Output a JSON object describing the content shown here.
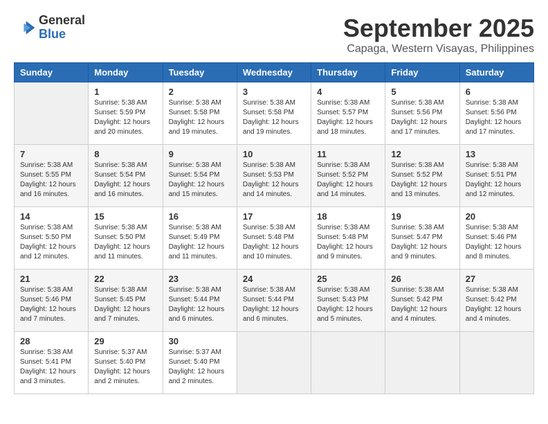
{
  "logo": {
    "general": "General",
    "blue": "Blue"
  },
  "title": "September 2025",
  "location": "Capaga, Western Visayas, Philippines",
  "days_of_week": [
    "Sunday",
    "Monday",
    "Tuesday",
    "Wednesday",
    "Thursday",
    "Friday",
    "Saturday"
  ],
  "weeks": [
    [
      {
        "day": "",
        "info": ""
      },
      {
        "day": "1",
        "info": "Sunrise: 5:38 AM\nSunset: 5:59 PM\nDaylight: 12 hours\nand 20 minutes."
      },
      {
        "day": "2",
        "info": "Sunrise: 5:38 AM\nSunset: 5:58 PM\nDaylight: 12 hours\nand 19 minutes."
      },
      {
        "day": "3",
        "info": "Sunrise: 5:38 AM\nSunset: 5:58 PM\nDaylight: 12 hours\nand 19 minutes."
      },
      {
        "day": "4",
        "info": "Sunrise: 5:38 AM\nSunset: 5:57 PM\nDaylight: 12 hours\nand 18 minutes."
      },
      {
        "day": "5",
        "info": "Sunrise: 5:38 AM\nSunset: 5:56 PM\nDaylight: 12 hours\nand 17 minutes."
      },
      {
        "day": "6",
        "info": "Sunrise: 5:38 AM\nSunset: 5:56 PM\nDaylight: 12 hours\nand 17 minutes."
      }
    ],
    [
      {
        "day": "7",
        "info": "Sunrise: 5:38 AM\nSunset: 5:55 PM\nDaylight: 12 hours\nand 16 minutes."
      },
      {
        "day": "8",
        "info": "Sunrise: 5:38 AM\nSunset: 5:54 PM\nDaylight: 12 hours\nand 16 minutes."
      },
      {
        "day": "9",
        "info": "Sunrise: 5:38 AM\nSunset: 5:54 PM\nDaylight: 12 hours\nand 15 minutes."
      },
      {
        "day": "10",
        "info": "Sunrise: 5:38 AM\nSunset: 5:53 PM\nDaylight: 12 hours\nand 14 minutes."
      },
      {
        "day": "11",
        "info": "Sunrise: 5:38 AM\nSunset: 5:52 PM\nDaylight: 12 hours\nand 14 minutes."
      },
      {
        "day": "12",
        "info": "Sunrise: 5:38 AM\nSunset: 5:52 PM\nDaylight: 12 hours\nand 13 minutes."
      },
      {
        "day": "13",
        "info": "Sunrise: 5:38 AM\nSunset: 5:51 PM\nDaylight: 12 hours\nand 12 minutes."
      }
    ],
    [
      {
        "day": "14",
        "info": "Sunrise: 5:38 AM\nSunset: 5:50 PM\nDaylight: 12 hours\nand 12 minutes."
      },
      {
        "day": "15",
        "info": "Sunrise: 5:38 AM\nSunset: 5:50 PM\nDaylight: 12 hours\nand 11 minutes."
      },
      {
        "day": "16",
        "info": "Sunrise: 5:38 AM\nSunset: 5:49 PM\nDaylight: 12 hours\nand 11 minutes."
      },
      {
        "day": "17",
        "info": "Sunrise: 5:38 AM\nSunset: 5:48 PM\nDaylight: 12 hours\nand 10 minutes."
      },
      {
        "day": "18",
        "info": "Sunrise: 5:38 AM\nSunset: 5:48 PM\nDaylight: 12 hours\nand 9 minutes."
      },
      {
        "day": "19",
        "info": "Sunrise: 5:38 AM\nSunset: 5:47 PM\nDaylight: 12 hours\nand 9 minutes."
      },
      {
        "day": "20",
        "info": "Sunrise: 5:38 AM\nSunset: 5:46 PM\nDaylight: 12 hours\nand 8 minutes."
      }
    ],
    [
      {
        "day": "21",
        "info": "Sunrise: 5:38 AM\nSunset: 5:46 PM\nDaylight: 12 hours\nand 7 minutes."
      },
      {
        "day": "22",
        "info": "Sunrise: 5:38 AM\nSunset: 5:45 PM\nDaylight: 12 hours\nand 7 minutes."
      },
      {
        "day": "23",
        "info": "Sunrise: 5:38 AM\nSunset: 5:44 PM\nDaylight: 12 hours\nand 6 minutes."
      },
      {
        "day": "24",
        "info": "Sunrise: 5:38 AM\nSunset: 5:44 PM\nDaylight: 12 hours\nand 6 minutes."
      },
      {
        "day": "25",
        "info": "Sunrise: 5:38 AM\nSunset: 5:43 PM\nDaylight: 12 hours\nand 5 minutes."
      },
      {
        "day": "26",
        "info": "Sunrise: 5:38 AM\nSunset: 5:42 PM\nDaylight: 12 hours\nand 4 minutes."
      },
      {
        "day": "27",
        "info": "Sunrise: 5:38 AM\nSunset: 5:42 PM\nDaylight: 12 hours\nand 4 minutes."
      }
    ],
    [
      {
        "day": "28",
        "info": "Sunrise: 5:38 AM\nSunset: 5:41 PM\nDaylight: 12 hours\nand 3 minutes."
      },
      {
        "day": "29",
        "info": "Sunrise: 5:37 AM\nSunset: 5:40 PM\nDaylight: 12 hours\nand 2 minutes."
      },
      {
        "day": "30",
        "info": "Sunrise: 5:37 AM\nSunset: 5:40 PM\nDaylight: 12 hours\nand 2 minutes."
      },
      {
        "day": "",
        "info": ""
      },
      {
        "day": "",
        "info": ""
      },
      {
        "day": "",
        "info": ""
      },
      {
        "day": "",
        "info": ""
      }
    ]
  ]
}
